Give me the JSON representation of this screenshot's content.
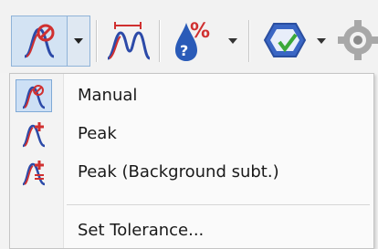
{
  "toolbar": {
    "buttons": [
      {
        "icon": "manual-integration-icon"
      },
      {
        "icon": "dropdown-arrow-icon"
      },
      {
        "icon": "peak-markers-icon"
      },
      {
        "icon": "percent-drop-icon"
      },
      {
        "icon": "tolerance-badge-icon"
      },
      {
        "icon": "settings-gear-icon"
      }
    ]
  },
  "menu": {
    "items": [
      {
        "label": "Manual",
        "icon": "manual-peak-icon",
        "checked": true
      },
      {
        "label": "Peak",
        "icon": "peak-plus-icon",
        "checked": false
      },
      {
        "label": "Peak (Background subt.)",
        "icon": "peak-background-icon",
        "checked": false
      }
    ],
    "footer_item": {
      "label": "Set Tolerance..."
    }
  },
  "colors": {
    "accent": "#7fa9d6",
    "peak_red": "#d03030",
    "peak_blue": "#2c4aa8"
  }
}
